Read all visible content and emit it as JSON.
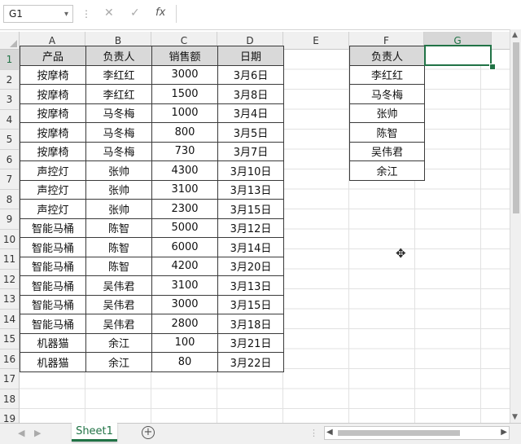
{
  "formula_bar": {
    "name_box": "G1",
    "name_box_dropdown": "▾",
    "dots": "⋮",
    "cancel_icon": "✕",
    "enter_icon": "✓",
    "fx_label": "fx",
    "formula": ""
  },
  "columns": [
    "A",
    "B",
    "C",
    "D",
    "E",
    "F",
    "G"
  ],
  "rows": [
    "1",
    "2",
    "3",
    "4",
    "5",
    "6",
    "7",
    "8",
    "9",
    "10",
    "11",
    "12",
    "13",
    "14",
    "15",
    "16",
    "17",
    "18",
    "19"
  ],
  "table1": {
    "headers": [
      "产品",
      "负责人",
      "销售额",
      "日期"
    ],
    "rows": [
      [
        "按摩椅",
        "李红红",
        "3000",
        "3月6日"
      ],
      [
        "按摩椅",
        "李红红",
        "1500",
        "3月8日"
      ],
      [
        "按摩椅",
        "马冬梅",
        "1000",
        "3月4日"
      ],
      [
        "按摩椅",
        "马冬梅",
        "800",
        "3月5日"
      ],
      [
        "按摩椅",
        "马冬梅",
        "730",
        "3月7日"
      ],
      [
        "声控灯",
        "张帅",
        "4300",
        "3月10日"
      ],
      [
        "声控灯",
        "张帅",
        "3100",
        "3月13日"
      ],
      [
        "声控灯",
        "张帅",
        "2300",
        "3月15日"
      ],
      [
        "智能马桶",
        "陈智",
        "5000",
        "3月12日"
      ],
      [
        "智能马桶",
        "陈智",
        "6000",
        "3月14日"
      ],
      [
        "智能马桶",
        "陈智",
        "4200",
        "3月20日"
      ],
      [
        "智能马桶",
        "吴伟君",
        "3100",
        "3月13日"
      ],
      [
        "智能马桶",
        "吴伟君",
        "3000",
        "3月15日"
      ],
      [
        "智能马桶",
        "吴伟君",
        "2800",
        "3月18日"
      ],
      [
        "机器猫",
        "余江",
        "100",
        "3月21日"
      ],
      [
        "机器猫",
        "余江",
        "80",
        "3月22日"
      ]
    ]
  },
  "table2": {
    "header": "负责人",
    "rows": [
      "李红红",
      "马冬梅",
      "张帅",
      "陈智",
      "吴伟君",
      "余江"
    ]
  },
  "selected_cell": "G1",
  "sheet_tabs": {
    "active": "Sheet1",
    "add_icon": "+",
    "prev_icon": "◀",
    "next_icon": "▶",
    "dots": "⋮"
  },
  "icons": {
    "cursor": "✥",
    "scroll_up": "▲",
    "scroll_down": "▼",
    "scroll_left": "◀",
    "scroll_right": "▶"
  }
}
